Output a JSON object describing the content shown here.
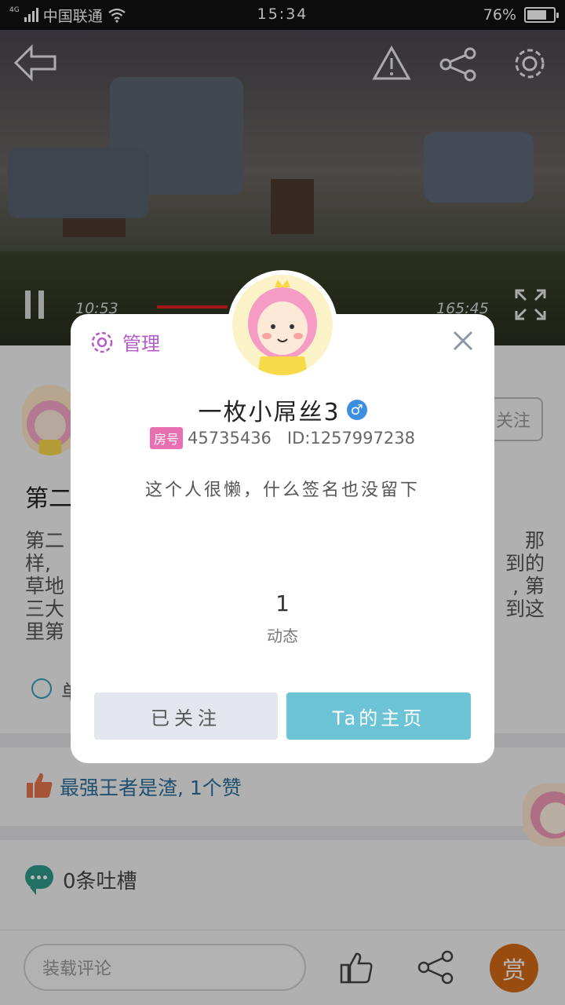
{
  "status_bar": {
    "network": "4G",
    "carrier": "中国联通",
    "time": "15:34",
    "battery": "76%",
    "battery_level": 0.76
  },
  "video": {
    "current_time": "10:53",
    "total_time": "165:45"
  },
  "post": {
    "title": "第二",
    "body_left": [
      "第二",
      "样,",
      "草地",
      "三大",
      "里第"
    ],
    "body_right": [
      "那",
      "到的",
      ", 第",
      "到这"
    ],
    "follow_label": "关注",
    "section_label": "单"
  },
  "likes": {
    "text": "最强王者是渣, 1个赞"
  },
  "comments": {
    "count_text": "0条吐槽"
  },
  "bottom_bar": {
    "comment_placeholder": "装载评论",
    "reward_label": "赏"
  },
  "dialog": {
    "manage_label": "管理",
    "username": "一枚小屌丝3",
    "gender_symbol": "♂",
    "room_badge": "房号",
    "room_number": "45735436",
    "user_id": "ID:1257997238",
    "signature": "这个人很懒，什么签名也没留下",
    "stat_value": "1",
    "stat_label": "动态",
    "followed_button": "已关注",
    "homepage_button": "Ta的主页"
  },
  "colors": {
    "accent_teal": "#6cc3d5",
    "manage_purple": "#b45cc6",
    "room_badge_pink": "#e96fb3",
    "reward_orange": "#d46a16",
    "gender_blue": "#3b8fe0"
  }
}
